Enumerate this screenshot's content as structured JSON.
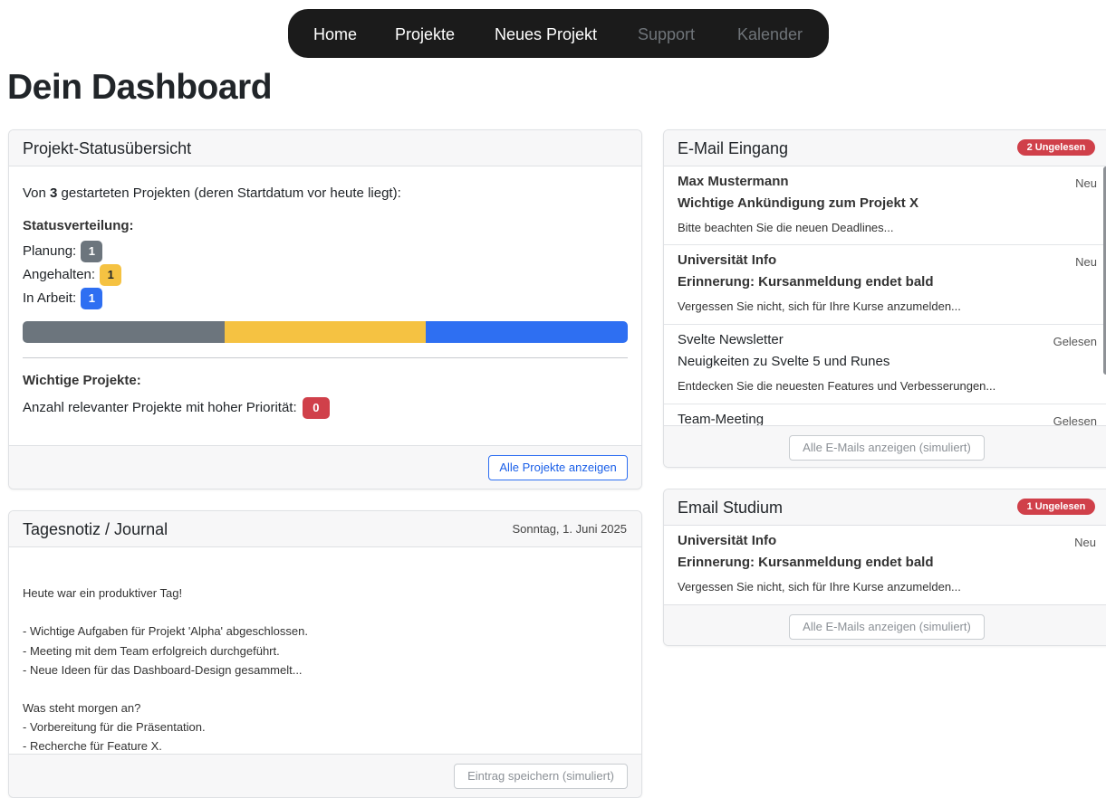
{
  "nav": {
    "items": [
      "Home",
      "Projekte",
      "Neues Projekt",
      "Support",
      "Kalender"
    ]
  },
  "page_title": "Dein Dashboard",
  "colors": {
    "gray": "#6c757d",
    "yellow": "#f5c242",
    "blue": "#2e6ff2",
    "red": "#d0404a"
  },
  "status_card": {
    "title": "Projekt-Statusübersicht",
    "intro_prefix": "Von ",
    "intro_count": "3",
    "intro_suffix": " gestarteten Projekten (deren Startdatum vor heute liegt):",
    "distribution_title": "Statusverteilung:",
    "statuses": [
      {
        "label": "Planung:",
        "count": "1",
        "color": "gray"
      },
      {
        "label": "Angehalten:",
        "count": "1",
        "color": "yellow"
      },
      {
        "label": "In Arbeit:",
        "count": "1",
        "color": "blue"
      }
    ],
    "progress_shares": [
      0.3333,
      0.3333,
      0.3334
    ],
    "important_title": "Wichtige Projekte:",
    "important_text": "Anzahl relevanter Projekte mit hoher Priorität:",
    "important_count": "0",
    "button": "Alle Projekte anzeigen"
  },
  "journal": {
    "title": "Tagesnotiz / Journal",
    "date": "Sonntag, 1. Juni 2025",
    "lines": [
      "Heute war ein produktiver Tag!",
      "",
      "- Wichtige Aufgaben für Projekt 'Alpha' abgeschlossen.",
      "- Meeting mit dem Team erfolgreich durchgeführt.",
      "- Neue Ideen für das Dashboard-Design gesammelt...",
      "",
      "Was steht morgen an?",
      "- Vorbereitung für die Präsentation.",
      "- Recherche für Feature X."
    ],
    "button": "Eintrag speichern (simuliert)"
  },
  "inbox": {
    "title": "E-Mail Eingang",
    "badge": "2 Ungelesen",
    "emails": [
      {
        "sender": "Max Mustermann",
        "status": "Neu",
        "subject": "Wichtige Ankündigung zum Projekt X",
        "preview": "Bitte beachten Sie die neuen Deadlines...",
        "unread": true
      },
      {
        "sender": "Universität Info",
        "status": "Neu",
        "subject": "Erinnerung: Kursanmeldung endet bald",
        "preview": "Vergessen Sie nicht, sich für Ihre Kurse anzumelden...",
        "unread": true
      },
      {
        "sender": "Svelte Newsletter",
        "status": "Gelesen",
        "subject": "Neuigkeiten zu Svelte 5 und Runes",
        "preview": "Entdecken Sie die neuesten Features und Verbesserungen...",
        "unread": false
      },
      {
        "sender": "Team-Meeting",
        "status": "Gelesen",
        "subject": "",
        "preview": "",
        "unread": false
      }
    ],
    "button": "Alle E-Mails anzeigen (simuliert)"
  },
  "study": {
    "title": "Email Studium",
    "badge": "1 Ungelesen",
    "emails": [
      {
        "sender": "Universität Info",
        "status": "Neu",
        "subject": "Erinnerung: Kursanmeldung endet bald",
        "preview": "Vergessen Sie nicht, sich für Ihre Kurse anzumelden...",
        "unread": true
      }
    ],
    "button": "Alle E-Mails anzeigen (simuliert)"
  }
}
